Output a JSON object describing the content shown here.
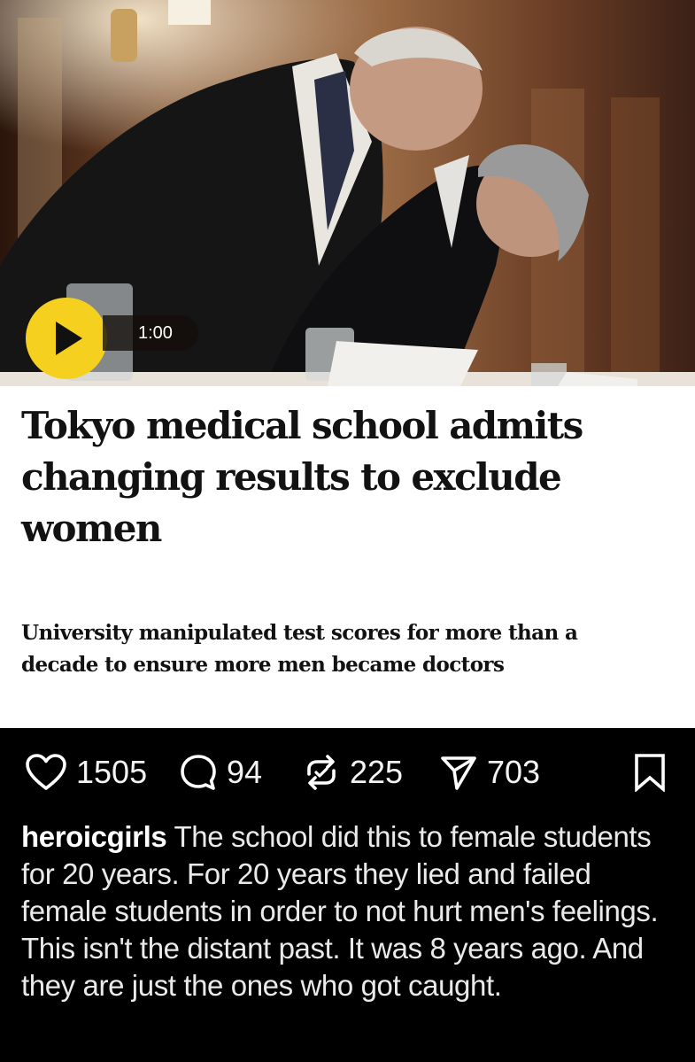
{
  "video": {
    "duration": "1:00"
  },
  "article": {
    "headline": "Tokyo medical school admits changing results to exclude women",
    "standfirst": "University manipulated test scores for more than a decade to ensure more men became doctors"
  },
  "actions": {
    "likes": "1505",
    "comments": "94",
    "reposts": "225",
    "shares": "703"
  },
  "post": {
    "username": "heroicgirls",
    "caption": "The school did this to female students for 20 years. For 20 years they lied and failed female students in order to not hurt men's feelings. This isn't the distant past. It was 8 years ago. And they are just the ones who got caught."
  },
  "colors": {
    "play_button": "#f5d01e",
    "background": "#000000",
    "card": "#ffffff"
  },
  "icons": [
    "play-icon",
    "heart-icon",
    "comment-icon",
    "repost-icon",
    "share-icon",
    "bookmark-icon"
  ]
}
